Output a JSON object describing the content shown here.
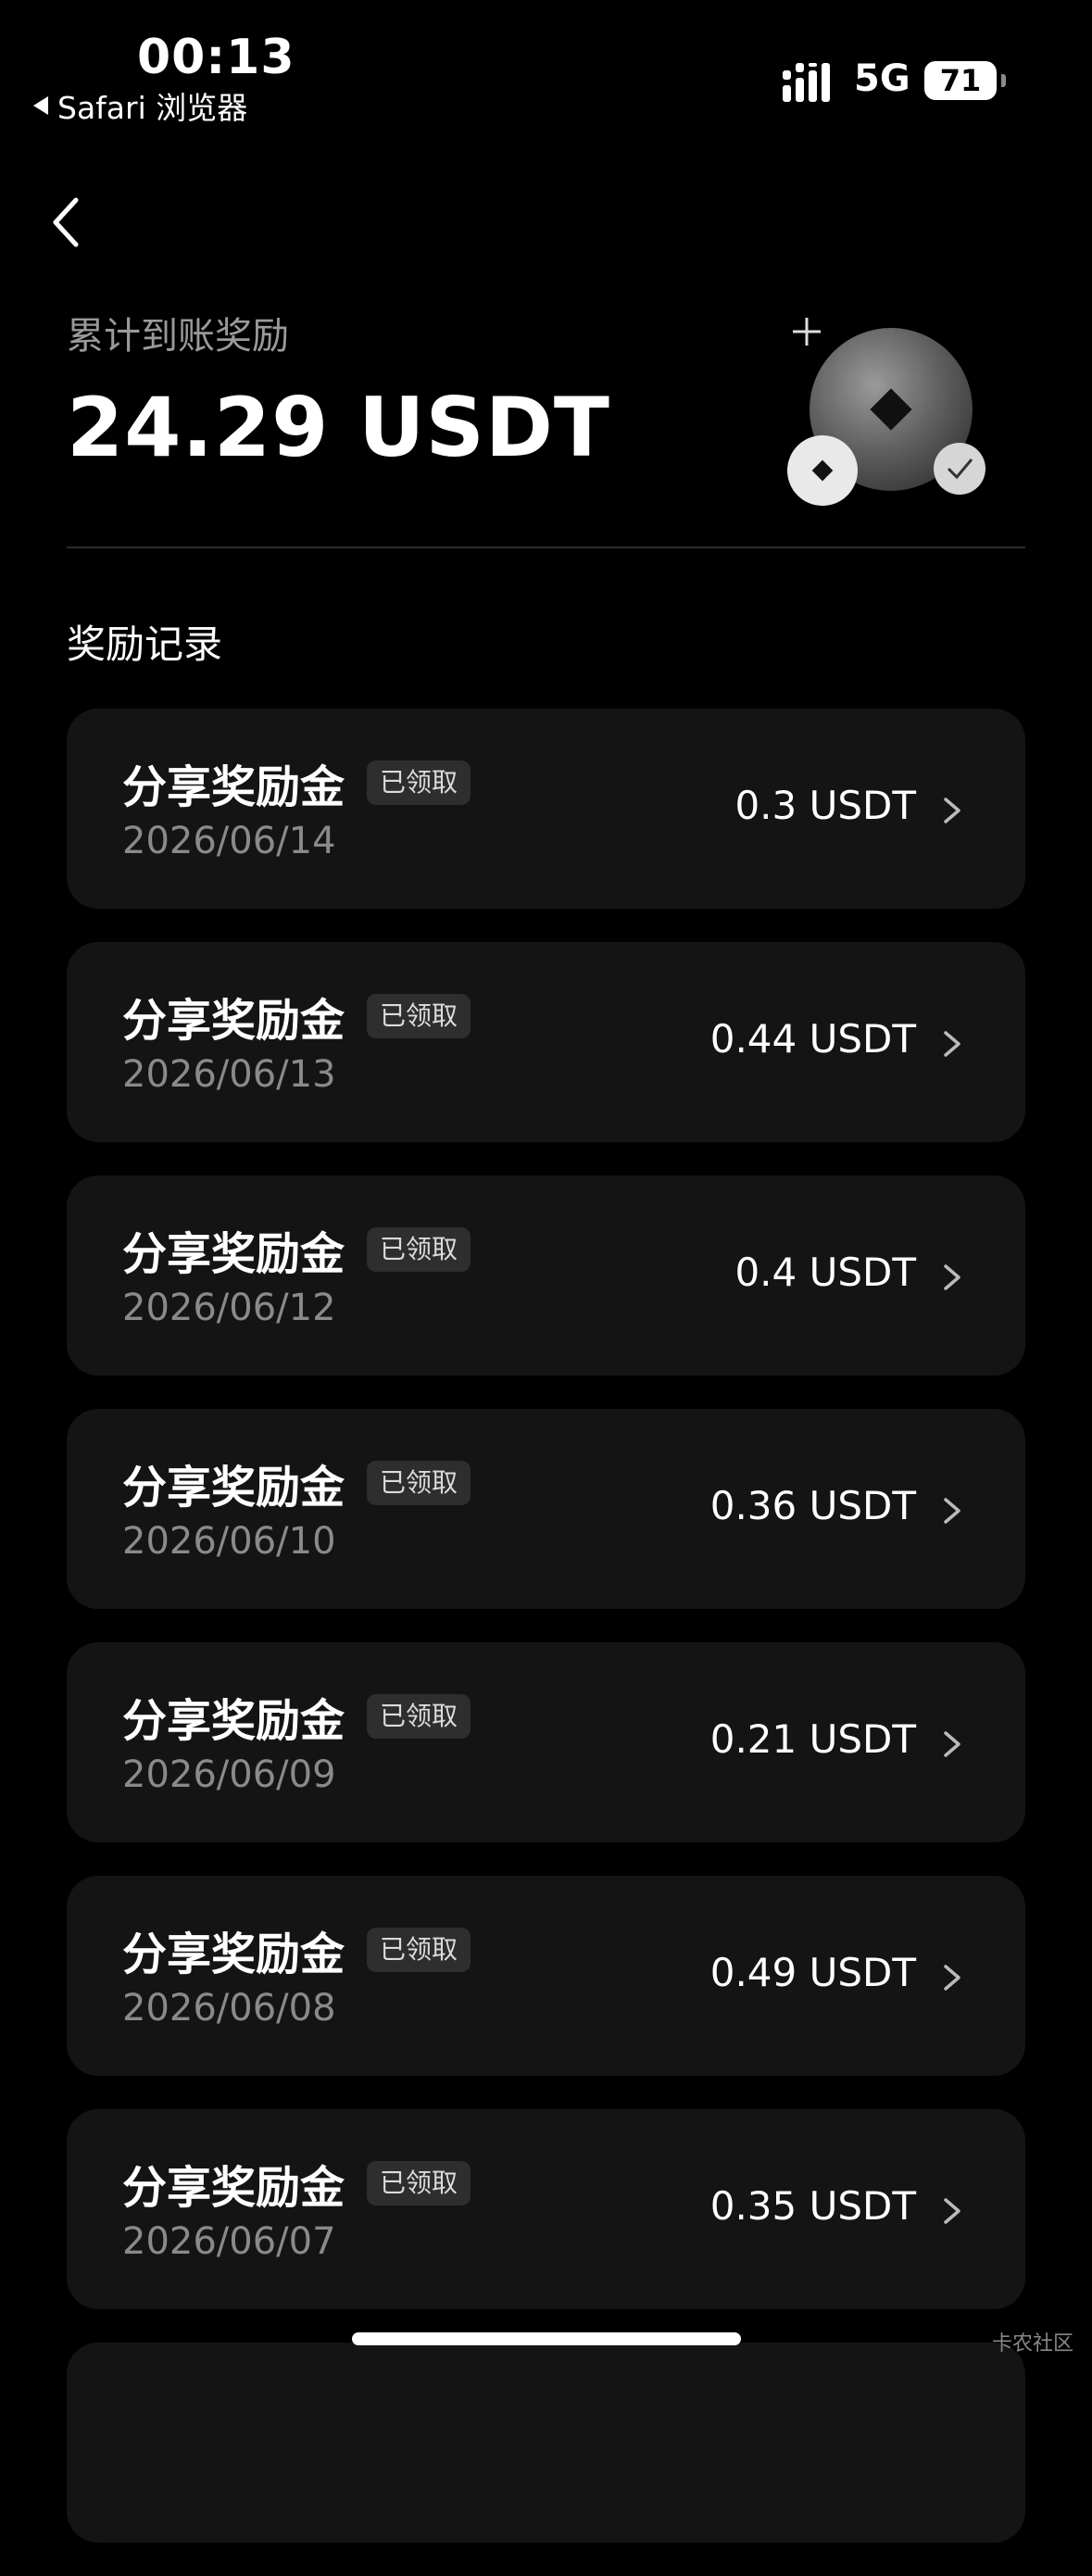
{
  "status_bar": {
    "time": "00:13",
    "back_app": "Safari 浏览器",
    "network": "5G",
    "battery": "71"
  },
  "summary": {
    "label": "累计到账奖励",
    "amount": "24.29 USDT"
  },
  "section_title": "奖励记录",
  "records": [
    {
      "title": "分享奖励金",
      "badge": "已领取",
      "date": "2026/06/14",
      "amount": "0.3 USDT"
    },
    {
      "title": "分享奖励金",
      "badge": "已领取",
      "date": "2026/06/13",
      "amount": "0.44 USDT"
    },
    {
      "title": "分享奖励金",
      "badge": "已领取",
      "date": "2026/06/12",
      "amount": "0.4 USDT"
    },
    {
      "title": "分享奖励金",
      "badge": "已领取",
      "date": "2026/06/10",
      "amount": "0.36 USDT"
    },
    {
      "title": "分享奖励金",
      "badge": "已领取",
      "date": "2026/06/09",
      "amount": "0.21 USDT"
    },
    {
      "title": "分享奖励金",
      "badge": "已领取",
      "date": "2026/06/08",
      "amount": "0.49 USDT"
    },
    {
      "title": "分享奖励金",
      "badge": "已领取",
      "date": "2026/06/07",
      "amount": "0.35 USDT"
    }
  ],
  "watermark": "卡农社区",
  "icons": {
    "back": "chevron-left-icon",
    "row_chevron": "chevron-right-icon",
    "illustration": "coin-reward-illustration"
  }
}
